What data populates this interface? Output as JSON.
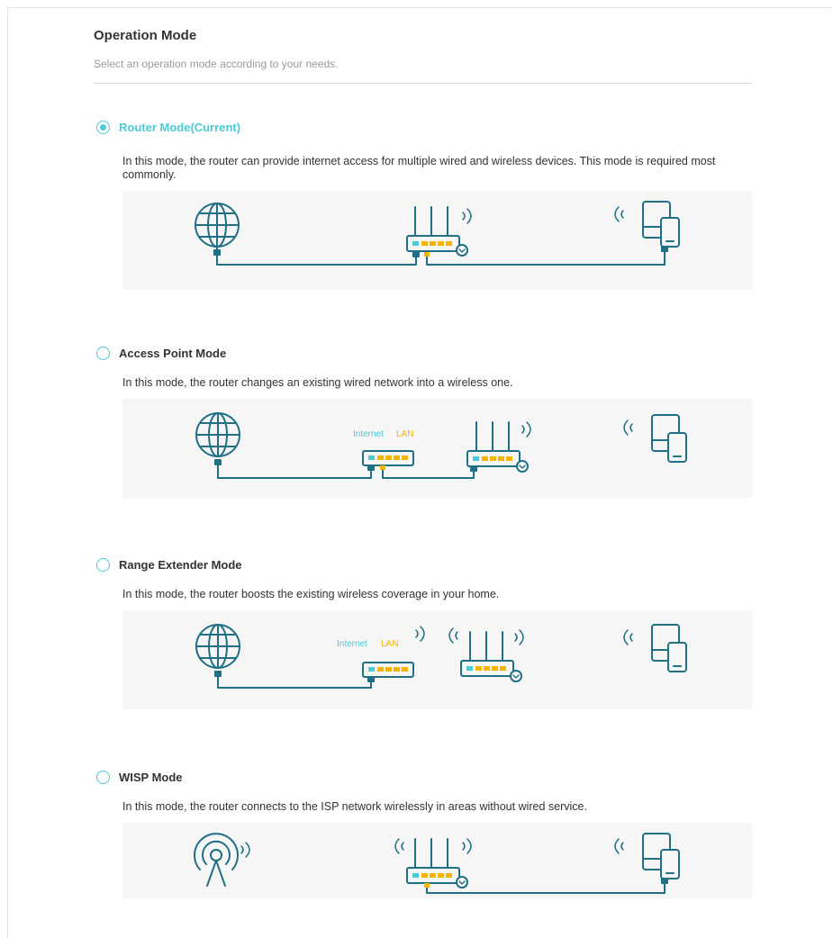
{
  "page": {
    "title": "Operation Mode",
    "subtitle": "Select an operation mode according to your needs."
  },
  "modes": [
    {
      "label": "Router Mode(Current)",
      "selected": true,
      "description": "In this mode, the router can provide internet access for multiple wired and wireless devices. This mode is required most commonly."
    },
    {
      "label": "Access Point Mode",
      "selected": false,
      "description": "In this mode, the router changes an existing wired network into a wireless one.",
      "diagram_labels": {
        "internet": "Internet",
        "lan": "LAN"
      }
    },
    {
      "label": "Range Extender Mode",
      "selected": false,
      "description": "In this mode, the router boosts the existing wireless coverage in your home.",
      "diagram_labels": {
        "internet": "Internet",
        "lan": "LAN"
      }
    },
    {
      "label": "WISP Mode",
      "selected": false,
      "description": "In this mode, the router connects to the ISP network wirelessly in areas without wired service."
    }
  ],
  "colors": {
    "accent": "#4acbd6",
    "line": "#1f6f85",
    "port": "#f4b400"
  }
}
